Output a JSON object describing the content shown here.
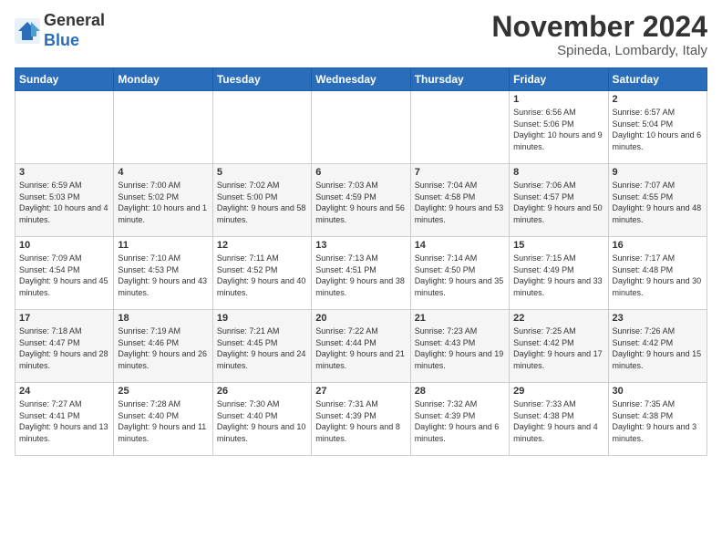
{
  "logo": {
    "general": "General",
    "blue": "Blue"
  },
  "header": {
    "month": "November 2024",
    "location": "Spineda, Lombardy, Italy"
  },
  "weekdays": [
    "Sunday",
    "Monday",
    "Tuesday",
    "Wednesday",
    "Thursday",
    "Friday",
    "Saturday"
  ],
  "weeks": [
    [
      {
        "day": "",
        "info": ""
      },
      {
        "day": "",
        "info": ""
      },
      {
        "day": "",
        "info": ""
      },
      {
        "day": "",
        "info": ""
      },
      {
        "day": "",
        "info": ""
      },
      {
        "day": "1",
        "info": "Sunrise: 6:56 AM\nSunset: 5:06 PM\nDaylight: 10 hours and 9 minutes."
      },
      {
        "day": "2",
        "info": "Sunrise: 6:57 AM\nSunset: 5:04 PM\nDaylight: 10 hours and 6 minutes."
      }
    ],
    [
      {
        "day": "3",
        "info": "Sunrise: 6:59 AM\nSunset: 5:03 PM\nDaylight: 10 hours and 4 minutes."
      },
      {
        "day": "4",
        "info": "Sunrise: 7:00 AM\nSunset: 5:02 PM\nDaylight: 10 hours and 1 minute."
      },
      {
        "day": "5",
        "info": "Sunrise: 7:02 AM\nSunset: 5:00 PM\nDaylight: 9 hours and 58 minutes."
      },
      {
        "day": "6",
        "info": "Sunrise: 7:03 AM\nSunset: 4:59 PM\nDaylight: 9 hours and 56 minutes."
      },
      {
        "day": "7",
        "info": "Sunrise: 7:04 AM\nSunset: 4:58 PM\nDaylight: 9 hours and 53 minutes."
      },
      {
        "day": "8",
        "info": "Sunrise: 7:06 AM\nSunset: 4:57 PM\nDaylight: 9 hours and 50 minutes."
      },
      {
        "day": "9",
        "info": "Sunrise: 7:07 AM\nSunset: 4:55 PM\nDaylight: 9 hours and 48 minutes."
      }
    ],
    [
      {
        "day": "10",
        "info": "Sunrise: 7:09 AM\nSunset: 4:54 PM\nDaylight: 9 hours and 45 minutes."
      },
      {
        "day": "11",
        "info": "Sunrise: 7:10 AM\nSunset: 4:53 PM\nDaylight: 9 hours and 43 minutes."
      },
      {
        "day": "12",
        "info": "Sunrise: 7:11 AM\nSunset: 4:52 PM\nDaylight: 9 hours and 40 minutes."
      },
      {
        "day": "13",
        "info": "Sunrise: 7:13 AM\nSunset: 4:51 PM\nDaylight: 9 hours and 38 minutes."
      },
      {
        "day": "14",
        "info": "Sunrise: 7:14 AM\nSunset: 4:50 PM\nDaylight: 9 hours and 35 minutes."
      },
      {
        "day": "15",
        "info": "Sunrise: 7:15 AM\nSunset: 4:49 PM\nDaylight: 9 hours and 33 minutes."
      },
      {
        "day": "16",
        "info": "Sunrise: 7:17 AM\nSunset: 4:48 PM\nDaylight: 9 hours and 30 minutes."
      }
    ],
    [
      {
        "day": "17",
        "info": "Sunrise: 7:18 AM\nSunset: 4:47 PM\nDaylight: 9 hours and 28 minutes."
      },
      {
        "day": "18",
        "info": "Sunrise: 7:19 AM\nSunset: 4:46 PM\nDaylight: 9 hours and 26 minutes."
      },
      {
        "day": "19",
        "info": "Sunrise: 7:21 AM\nSunset: 4:45 PM\nDaylight: 9 hours and 24 minutes."
      },
      {
        "day": "20",
        "info": "Sunrise: 7:22 AM\nSunset: 4:44 PM\nDaylight: 9 hours and 21 minutes."
      },
      {
        "day": "21",
        "info": "Sunrise: 7:23 AM\nSunset: 4:43 PM\nDaylight: 9 hours and 19 minutes."
      },
      {
        "day": "22",
        "info": "Sunrise: 7:25 AM\nSunset: 4:42 PM\nDaylight: 9 hours and 17 minutes."
      },
      {
        "day": "23",
        "info": "Sunrise: 7:26 AM\nSunset: 4:42 PM\nDaylight: 9 hours and 15 minutes."
      }
    ],
    [
      {
        "day": "24",
        "info": "Sunrise: 7:27 AM\nSunset: 4:41 PM\nDaylight: 9 hours and 13 minutes."
      },
      {
        "day": "25",
        "info": "Sunrise: 7:28 AM\nSunset: 4:40 PM\nDaylight: 9 hours and 11 minutes."
      },
      {
        "day": "26",
        "info": "Sunrise: 7:30 AM\nSunset: 4:40 PM\nDaylight: 9 hours and 10 minutes."
      },
      {
        "day": "27",
        "info": "Sunrise: 7:31 AM\nSunset: 4:39 PM\nDaylight: 9 hours and 8 minutes."
      },
      {
        "day": "28",
        "info": "Sunrise: 7:32 AM\nSunset: 4:39 PM\nDaylight: 9 hours and 6 minutes."
      },
      {
        "day": "29",
        "info": "Sunrise: 7:33 AM\nSunset: 4:38 PM\nDaylight: 9 hours and 4 minutes."
      },
      {
        "day": "30",
        "info": "Sunrise: 7:35 AM\nSunset: 4:38 PM\nDaylight: 9 hours and 3 minutes."
      }
    ]
  ]
}
